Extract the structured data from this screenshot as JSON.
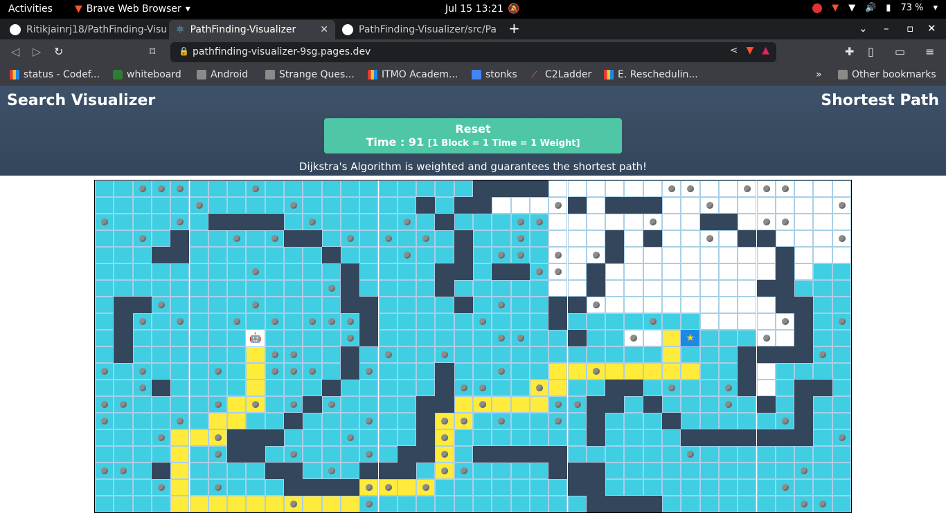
{
  "system": {
    "activities": "Activities",
    "app_name": "Brave Web Browser",
    "clock": "Jul 15  13:21",
    "battery": "73 %"
  },
  "tabs": [
    {
      "title": "Ritikjainrj18/PathFinding-Visu"
    },
    {
      "title": "PathFinding-Visualizer"
    },
    {
      "title": "PathFinding-Visualizer/src/Pa"
    }
  ],
  "address": {
    "url": "pathfinding-visualizer-9sg.pages.dev"
  },
  "bookmarks": {
    "items": [
      {
        "label": "status - Codef..."
      },
      {
        "label": "whiteboard"
      },
      {
        "label": "Android"
      },
      {
        "label": "Strange Ques..."
      },
      {
        "label": "ITMO Academ..."
      },
      {
        "label": "stonks"
      },
      {
        "label": "C2Ladder"
      },
      {
        "label": "E. Reschedulin..."
      }
    ],
    "more": "»",
    "other": "Other bookmarks"
  },
  "app": {
    "title_left": "Search Visualizer",
    "title_right": "Shortest Path",
    "reset_label": "Reset",
    "time_label": "Time : 91",
    "time_note": "[1 Block = 1 Time = 1 Weight]",
    "description": "Dijkstra's Algorithm is weighted and guarantees the shortest path!"
  },
  "grid": {
    "rows": [
      "VVVVVVVVVVVVVVVVVVVVUUUUUUUUUUUUUUUUUUUU",
      "VVVVVVVVVVVVVVVVVVVVUUUUUUUUUUUUUUUUUUUU",
      "VVVVVVVVVVVVVVVVVVVVVVVVUUUUUUUUUUUUUUUU",
      "VVVVVVVVVVVVVVVVVVVVVVVVUUUUUUUUUUUUUUUU",
      "VVVVVVVVVVVVVVVVVVVVVVVVUUUUUUUUUUUUUUUU",
      "VVVVVVVVVVVVVVVVVVVVVVVVUUUUUUUUUUUUUUVV",
      "VVVVVVVVVVVVVVVVVVVVVVVVUUUUUUUUUUUUUVVV",
      "VVVVVVVVVVVVVVVVVVVVVVVVVVUUUUUUUUUUUVVV",
      "VVVVVVVVVVVVVVVVVVVVVVVVVVVVVVVVUUUUUUVV",
      "VVVVVVVVVVVVVVVVVVVVVVVVVVVVUUUUVVVUUVVV",
      "VVVVVVVVVVVVVVVVVVVVVVVVVVVVVVVVVVUUVVVV",
      "VVVVVVVVVVVVVVVVVVVVVVVVVVVVVVVVVVUUVVVV",
      "VVVVVVVVVVVVVVVVVVVVVVVVVVVVVVVVVVUUVVVV",
      "VVVVVVVVVVVVVVVVVVVVVVVVVVVVVVVVVVVVVVVV",
      "VVVVVVVVVVVVVVVVVVVVVVVVVVVVVVVVVVVVVVVV",
      "VVVVVVVVVVVVVVVVVVVVVVVVVVVVVVVVVVVVVVVV",
      "VVVVVVVVVVVVVVVVVVVVVVVVVVVVVVVVVVVVVVVV",
      "VVVVVVVVVVVVVVVVVVVVVVVVVVVVVVVVVVVVVVVV",
      "VVVVVVVVVVVVVVVVVVVVVVVVVVVVVVVVVVVVVVVV",
      "VVVVVVVVVVVVVVVVVVVVVVVVVVVVVVVVVVVVVVVV"
    ],
    "walls": [
      [
        0,
        20
      ],
      [
        0,
        21
      ],
      [
        0,
        22
      ],
      [
        0,
        23
      ],
      [
        1,
        17
      ],
      [
        1,
        19
      ],
      [
        1,
        20
      ],
      [
        1,
        25
      ],
      [
        1,
        27
      ],
      [
        1,
        28
      ],
      [
        1,
        29
      ],
      [
        2,
        6
      ],
      [
        2,
        7
      ],
      [
        2,
        8
      ],
      [
        2,
        9
      ],
      [
        2,
        18
      ],
      [
        2,
        32
      ],
      [
        2,
        33
      ],
      [
        3,
        4
      ],
      [
        3,
        10
      ],
      [
        3,
        11
      ],
      [
        3,
        19
      ],
      [
        3,
        27
      ],
      [
        3,
        29
      ],
      [
        3,
        34
      ],
      [
        3,
        35
      ],
      [
        4,
        3
      ],
      [
        4,
        4
      ],
      [
        4,
        12
      ],
      [
        4,
        19
      ],
      [
        4,
        27
      ],
      [
        4,
        36
      ],
      [
        5,
        13
      ],
      [
        5,
        18
      ],
      [
        5,
        19
      ],
      [
        5,
        21
      ],
      [
        5,
        22
      ],
      [
        5,
        26
      ],
      [
        5,
        36
      ],
      [
        6,
        13
      ],
      [
        6,
        18
      ],
      [
        6,
        26
      ],
      [
        6,
        35
      ],
      [
        6,
        36
      ],
      [
        7,
        1
      ],
      [
        7,
        2
      ],
      [
        7,
        13
      ],
      [
        7,
        14
      ],
      [
        7,
        19
      ],
      [
        7,
        24
      ],
      [
        7,
        25
      ],
      [
        7,
        36
      ],
      [
        7,
        37
      ],
      [
        8,
        1
      ],
      [
        8,
        14
      ],
      [
        8,
        24
      ],
      [
        8,
        37
      ],
      [
        9,
        1
      ],
      [
        9,
        14
      ],
      [
        9,
        25
      ],
      [
        9,
        37
      ],
      [
        10,
        1
      ],
      [
        10,
        13
      ],
      [
        10,
        34
      ],
      [
        10,
        35
      ],
      [
        10,
        36
      ],
      [
        10,
        37
      ],
      [
        11,
        13
      ],
      [
        11,
        18
      ],
      [
        11,
        34
      ],
      [
        12,
        3
      ],
      [
        12,
        12
      ],
      [
        12,
        18
      ],
      [
        12,
        27
      ],
      [
        12,
        28
      ],
      [
        12,
        34
      ],
      [
        12,
        37
      ],
      [
        12,
        38
      ],
      [
        13,
        11
      ],
      [
        13,
        17
      ],
      [
        13,
        18
      ],
      [
        13,
        26
      ],
      [
        13,
        27
      ],
      [
        13,
        29
      ],
      [
        13,
        35
      ],
      [
        13,
        37
      ],
      [
        14,
        10
      ],
      [
        14,
        17
      ],
      [
        14,
        26
      ],
      [
        14,
        30
      ],
      [
        14,
        37
      ],
      [
        15,
        7
      ],
      [
        15,
        8
      ],
      [
        15,
        9
      ],
      [
        15,
        17
      ],
      [
        15,
        26
      ],
      [
        15,
        31
      ],
      [
        15,
        32
      ],
      [
        15,
        33
      ],
      [
        15,
        34
      ],
      [
        15,
        35
      ],
      [
        15,
        36
      ],
      [
        15,
        37
      ],
      [
        16,
        7
      ],
      [
        16,
        8
      ],
      [
        16,
        16
      ],
      [
        16,
        17
      ],
      [
        16,
        20
      ],
      [
        16,
        21
      ],
      [
        16,
        22
      ],
      [
        16,
        23
      ],
      [
        16,
        24
      ],
      [
        17,
        3
      ],
      [
        17,
        9
      ],
      [
        17,
        10
      ],
      [
        17,
        14
      ],
      [
        17,
        15
      ],
      [
        17,
        16
      ],
      [
        17,
        24
      ],
      [
        17,
        25
      ],
      [
        17,
        26
      ],
      [
        18,
        10
      ],
      [
        18,
        11
      ],
      [
        18,
        12
      ],
      [
        18,
        13
      ],
      [
        18,
        25
      ],
      [
        18,
        26
      ],
      [
        19,
        26
      ],
      [
        19,
        27
      ],
      [
        19,
        28
      ],
      [
        19,
        29
      ]
    ],
    "path": [
      [
        9,
        8
      ],
      [
        10,
        8
      ],
      [
        11,
        8
      ],
      [
        12,
        8
      ],
      [
        13,
        7
      ],
      [
        13,
        8
      ],
      [
        14,
        6
      ],
      [
        14,
        7
      ],
      [
        15,
        4
      ],
      [
        15,
        5
      ],
      [
        15,
        6
      ],
      [
        16,
        4
      ],
      [
        17,
        4
      ],
      [
        18,
        4
      ],
      [
        19,
        4
      ],
      [
        19,
        5
      ],
      [
        19,
        6
      ],
      [
        19,
        7
      ],
      [
        19,
        8
      ],
      [
        19,
        9
      ],
      [
        19,
        10
      ],
      [
        19,
        11
      ],
      [
        19,
        12
      ],
      [
        19,
        13
      ],
      [
        18,
        14
      ],
      [
        18,
        15
      ],
      [
        18,
        16
      ],
      [
        18,
        17
      ],
      [
        17,
        18
      ],
      [
        16,
        18
      ],
      [
        15,
        18
      ],
      [
        14,
        18
      ],
      [
        14,
        19
      ],
      [
        13,
        19
      ],
      [
        13,
        20
      ],
      [
        13,
        21
      ],
      [
        13,
        22
      ],
      [
        13,
        23
      ],
      [
        12,
        23
      ],
      [
        12,
        24
      ],
      [
        11,
        24
      ],
      [
        11,
        25
      ],
      [
        11,
        26
      ],
      [
        11,
        27
      ],
      [
        11,
        28
      ],
      [
        11,
        29
      ],
      [
        11,
        30
      ],
      [
        11,
        31
      ],
      [
        10,
        30
      ],
      [
        9,
        30
      ]
    ],
    "start": [
      9,
      8
    ],
    "target": [
      9,
      31
    ]
  },
  "icons": {
    "start": "robot-icon",
    "target": "star-icon",
    "weight": "kettlebell-icon"
  },
  "colors": {
    "visited": "#40cee3",
    "wall": "#34465b",
    "path": "#ffeb3b",
    "target": "#1e88e5",
    "reset": "#4fc7a6"
  }
}
